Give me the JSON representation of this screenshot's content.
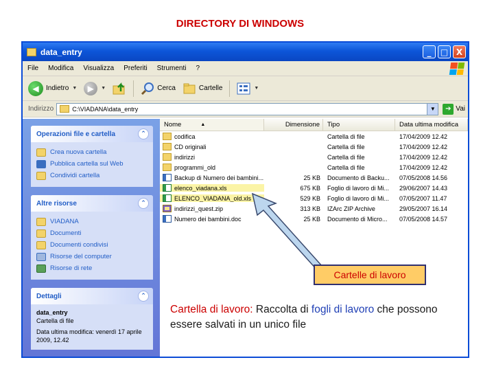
{
  "slide_title": "DIRECTORY DI WINDOWS",
  "window": {
    "title": "data_entry",
    "buttons": {
      "minimize": "_",
      "maximize": "□",
      "close": "X"
    }
  },
  "menubar": [
    "File",
    "Modifica",
    "Visualizza",
    "Preferiti",
    "Strumenti",
    "?"
  ],
  "toolbar": {
    "back_label": "Indietro",
    "search_label": "Cerca",
    "folders_label": "Cartelle"
  },
  "addressbar": {
    "label": "Indirizzo",
    "value": "C:\\VIADANA\\data_entry",
    "go_label": "Vai"
  },
  "taskpane": {
    "file_tasks": {
      "title": "Operazioni file e cartella",
      "items": [
        "Crea nuova cartella",
        "Pubblica cartella sul Web",
        "Condividi cartella"
      ]
    },
    "other_places": {
      "title": "Altre risorse",
      "items": [
        "VIADANA",
        "Documenti",
        "Documenti condivisi",
        "Risorse del computer",
        "Risorse di rete"
      ]
    },
    "details": {
      "title": "Dettagli",
      "name": "data_entry",
      "type": "Cartella di file",
      "modified": "Data ultima modifica: venerdì 17 aprile 2009, 12.42"
    }
  },
  "columns": {
    "name": "Nome",
    "size": "Dimensione",
    "type": "Tipo",
    "date": "Data ultima modifica"
  },
  "files": [
    {
      "name": "codifica",
      "size": "",
      "type": "Cartella di file",
      "date": "17/04/2009 12.42",
      "icon": "folder"
    },
    {
      "name": "CD originali",
      "size": "",
      "type": "Cartella di file",
      "date": "17/04/2009 12.42",
      "icon": "folder"
    },
    {
      "name": "indirizzi",
      "size": "",
      "type": "Cartella di file",
      "date": "17/04/2009 12.42",
      "icon": "folder"
    },
    {
      "name": "programmi_old",
      "size": "",
      "type": "Cartella di file",
      "date": "17/04/2009 12.42",
      "icon": "folder"
    },
    {
      "name": "Backup di Numero dei bambini...",
      "size": "25 KB",
      "type": "Documento di Backu...",
      "date": "07/05/2008 14.56",
      "icon": "doc"
    },
    {
      "name": "elenco_viadana.xls",
      "size": "675 KB",
      "type": "Foglio di lavoro di Mi...",
      "date": "29/06/2007 14.43",
      "icon": "xls"
    },
    {
      "name": "ELENCO_VIADANA_old.xls",
      "size": "529 KB",
      "type": "Foglio di lavoro di Mi...",
      "date": "07/05/2007 11.47",
      "icon": "xls"
    },
    {
      "name": "indirizzi_quest.zip",
      "size": "313 KB",
      "type": "IZArc ZIP Archive",
      "date": "29/05/2007 16.14",
      "icon": "zip"
    },
    {
      "name": "Numero dei bambini.doc",
      "size": "25 KB",
      "type": "Documento di Micro...",
      "date": "07/05/2008 14.57",
      "icon": "doc"
    }
  ],
  "callout_label": "Cartelle di lavoro",
  "caption": {
    "term": "Cartella di lavoro:",
    "part1": " Raccolta di ",
    "highlight": "fogli di lavoro",
    "part2": " che possono essere salvati in un unico file"
  }
}
